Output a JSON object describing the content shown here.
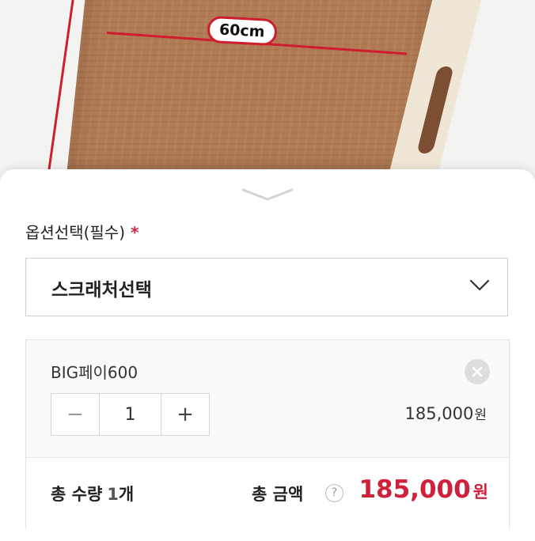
{
  "photo": {
    "dimension_label": "60cm",
    "colors": {
      "board": "#b07a55",
      "dimension_line": "#cf1d2d"
    }
  },
  "option": {
    "title": "옵션선택(필수)",
    "required_mark": "*",
    "select_value": "스크래처선택"
  },
  "selected_item": {
    "name": "BIG페이600",
    "quantity": "1",
    "price": "185,000",
    "currency": "원",
    "minus_label": "−",
    "plus_label": "+"
  },
  "total": {
    "qty_label": "총 수량",
    "qty_value": "1",
    "qty_unit": "개",
    "amount_label": "총 금액",
    "help_label": "?",
    "amount_value": "185,000",
    "currency": "원"
  },
  "accent_color": "#d0213c"
}
